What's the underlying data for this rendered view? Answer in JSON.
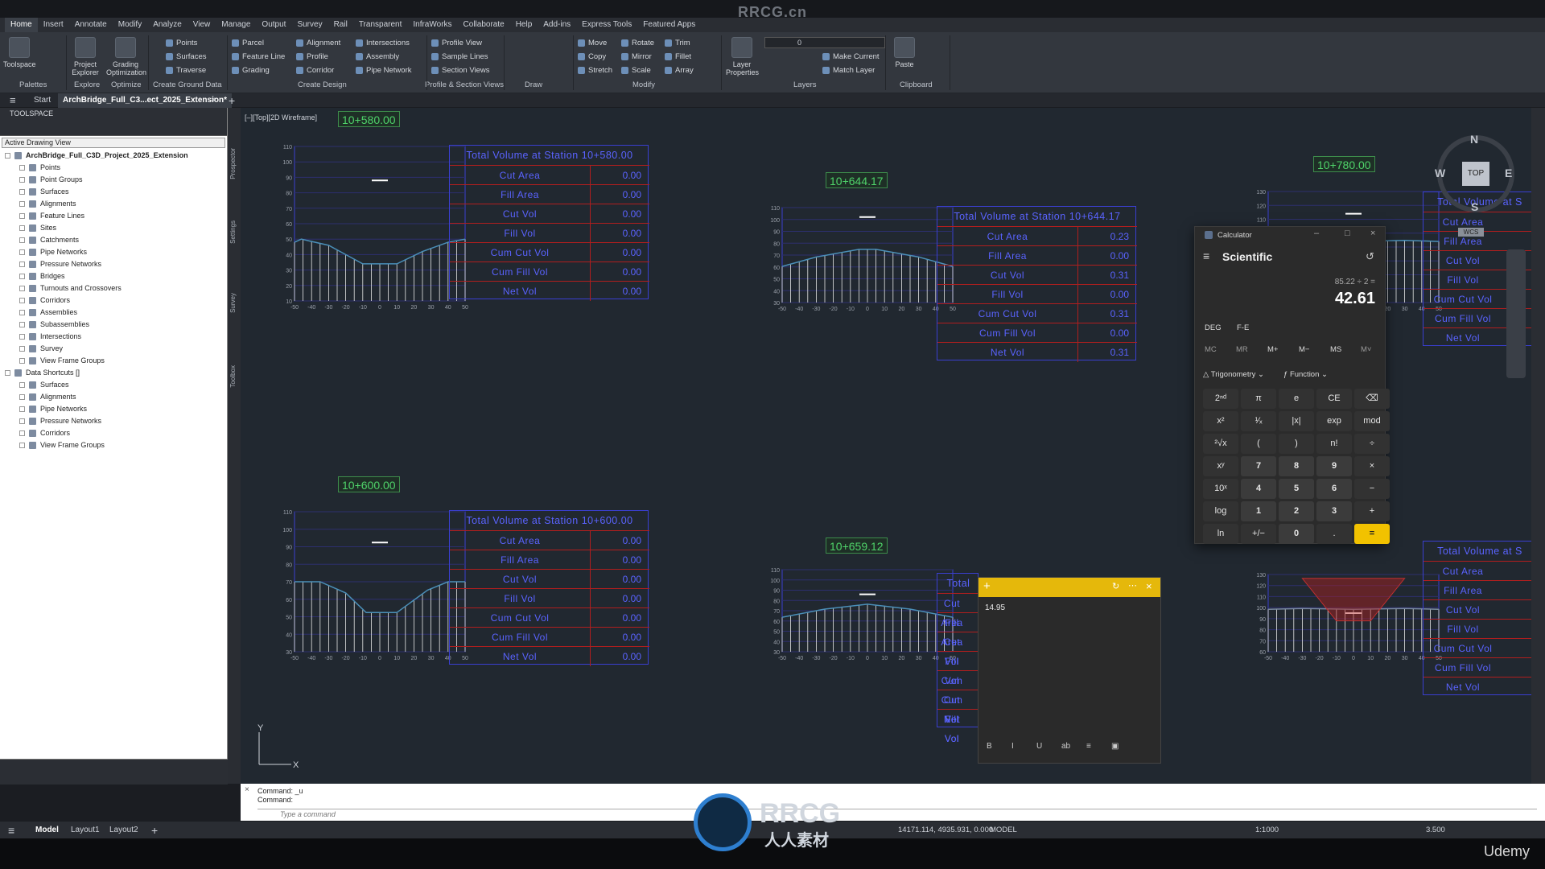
{
  "watermark": "RRCG.cn",
  "menu": [
    "Home",
    "Insert",
    "Annotate",
    "Modify",
    "Analyze",
    "View",
    "Manage",
    "Output",
    "Survey",
    "Rail",
    "Transparent",
    "InfraWorks",
    "Collaborate",
    "Help",
    "Add-ins",
    "Express Tools",
    "Featured Apps"
  ],
  "ribbon": {
    "toolspace": "Toolspace",
    "project_explorer": "Project\nExplorer",
    "grading_optimization": "Grading\nOptimization",
    "points": "Points",
    "surfaces": "Surfaces",
    "traverse": "Traverse",
    "parcel": "Parcel",
    "feature_line": "Feature Line",
    "grading": "Grading",
    "alignment": "Alignment",
    "profile": "Profile",
    "corridor": "Corridor",
    "intersections": "Intersections",
    "assembly": "Assembly",
    "pipe_network": "Pipe Network",
    "profile_view": "Profile View",
    "sample_lines": "Sample Lines",
    "section_views": "Section Views",
    "move": "Move",
    "copy": "Copy",
    "stretch": "Stretch",
    "rotate": "Rotate",
    "mirror": "Mirror",
    "scale": "Scale",
    "trim": "Trim",
    "fillet": "Fillet",
    "array": "Array",
    "layer_properties": "Layer\nProperties",
    "layer_value": "0",
    "make_current": "Make Current",
    "match_layer": "Match Layer",
    "paste": "Paste",
    "panels": [
      "Palettes",
      "Explore",
      "Optimize",
      "Create Ground Data",
      "Create Design",
      "Profile & Section Views",
      "Draw",
      "Modify",
      "Layers",
      "Clipboard"
    ]
  },
  "doctabs": {
    "start": "Start",
    "active": "ArchBridge_Full_C3...ect_2025_Extension*"
  },
  "toolspace": {
    "title": "TOOLSPACE",
    "view": "Active Drawing View",
    "tree": [
      {
        "label": "ArchBridge_Full_C3D_Project_2025_Extension",
        "level": 0,
        "bold": true
      },
      {
        "label": "Points",
        "level": 1
      },
      {
        "label": "Point Groups",
        "level": 1
      },
      {
        "label": "Surfaces",
        "level": 1
      },
      {
        "label": "Alignments",
        "level": 1
      },
      {
        "label": "Feature Lines",
        "level": 1
      },
      {
        "label": "Sites",
        "level": 1
      },
      {
        "label": "Catchments",
        "level": 1
      },
      {
        "label": "Pipe Networks",
        "level": 1
      },
      {
        "label": "Pressure Networks",
        "level": 1
      },
      {
        "label": "Bridges",
        "level": 1
      },
      {
        "label": "Turnouts and Crossovers",
        "level": 1
      },
      {
        "label": "Corridors",
        "level": 1
      },
      {
        "label": "Assemblies",
        "level": 1
      },
      {
        "label": "Subassemblies",
        "level": 1
      },
      {
        "label": "Intersections",
        "level": 1
      },
      {
        "label": "Survey",
        "level": 1
      },
      {
        "label": "View Frame Groups",
        "level": 1
      },
      {
        "label": "Data Shortcuts []",
        "level": 0
      },
      {
        "label": "Surfaces",
        "level": 1
      },
      {
        "label": "Alignments",
        "level": 1
      },
      {
        "label": "Pipe Networks",
        "level": 1
      },
      {
        "label": "Pressure Networks",
        "level": 1
      },
      {
        "label": "Corridors",
        "level": 1
      },
      {
        "label": "View Frame Groups",
        "level": 1
      }
    ]
  },
  "side_tabs": [
    "Prospector",
    "Settings",
    "Survey",
    "Toolbox"
  ],
  "viewport_label": "[–][Top][2D Wireframe]",
  "stations": [
    {
      "label": "10+580.00",
      "title": "Total Volume at Station 10+580.00",
      "values": [
        "0.00",
        "0.00",
        "0.00",
        "0.00",
        "0.00",
        "0.00",
        "0.00"
      ]
    },
    {
      "label": "10+600.00",
      "title": "Total Volume at Station 10+600.00",
      "values": [
        "0.00",
        "0.00",
        "0.00",
        "0.00",
        "0.00",
        "0.00",
        "0.00"
      ]
    },
    {
      "label": "10+644.17",
      "title": "Total Volume at Station 10+644.17",
      "values": [
        "0.23",
        "0.00",
        "0.31",
        "0.00",
        "0.31",
        "0.00",
        "0.31"
      ]
    },
    {
      "label": "10+659.12",
      "title": "Total",
      "values": []
    },
    {
      "label": "10+780.00",
      "title": "Total Volume at S",
      "values": []
    },
    {
      "label": "",
      "title": "Total Volume at S",
      "values": []
    }
  ],
  "row_labels": [
    "Cut Area",
    "Fill Area",
    "Cut Vol",
    "Fill Vol",
    "Cum Cut Vol",
    "Cum Fill Vol",
    "Net Vol"
  ],
  "axis_x_ticks": [
    "-50",
    "-40",
    "-30",
    "-20",
    "-10",
    "0",
    "10",
    "20",
    "30",
    "40",
    "50"
  ],
  "axis_y_ticks_a": [
    "110",
    "100",
    "90",
    "80",
    "70",
    "60",
    "50",
    "40",
    "30",
    "20",
    "10"
  ],
  "axis_y_ticks_b": [
    "110",
    "100",
    "90",
    "80",
    "70",
    "60",
    "50",
    "40",
    "30"
  ],
  "axis_y_ticks_c": [
    "130",
    "120",
    "110",
    "100",
    "90",
    "80",
    "70",
    "60",
    "50"
  ],
  "axis_y_ticks_d": [
    "130",
    "120",
    "110",
    "100",
    "90",
    "80",
    "70",
    "60"
  ],
  "viewcube": {
    "n": "N",
    "s": "S",
    "e": "E",
    "w": "W",
    "top": "TOP",
    "wcs": "WCS"
  },
  "calculator": {
    "window_title": "Calculator",
    "mode": "Scientific",
    "expression": "85.22 ÷ 2 =",
    "result": "42.61",
    "deg": "DEG",
    "fe": "F-E",
    "memory": [
      "MC",
      "MR",
      "M+",
      "M−",
      "MS",
      "M˅"
    ],
    "trig": "Trigonometry",
    "func": "Function",
    "keys": [
      [
        "2ⁿᵈ",
        "π",
        "e",
        "CE",
        "⌫"
      ],
      [
        "x²",
        "¹⁄ₓ",
        "|x|",
        "exp",
        "mod"
      ],
      [
        "²√x",
        "(",
        ")",
        "n!",
        "÷"
      ],
      [
        "xʸ",
        "7",
        "8",
        "9",
        "×"
      ],
      [
        "10ˣ",
        "4",
        "5",
        "6",
        "−"
      ],
      [
        "log",
        "1",
        "2",
        "3",
        "+"
      ],
      [
        "ln",
        "+/−",
        "0",
        ".",
        "="
      ]
    ]
  },
  "sticky_note": {
    "text": "14.95",
    "tools": [
      "B",
      "I",
      "U",
      "ab",
      "≡",
      "▣"
    ]
  },
  "command": {
    "history": [
      "Command: _u",
      "Command:"
    ],
    "placeholder": "Type a command"
  },
  "status": {
    "tabs": [
      "Model",
      "Layout1",
      "Layout2"
    ],
    "coords": "14171.114, 4935.931, 0.000",
    "space": "MODEL",
    "scale": "1:1000",
    "value": "3.500",
    "brand": "Udemy",
    "logo_text": "RRCG",
    "logo_sub": "人人素材"
  },
  "colors": {
    "cut_fill_blue": "#5a63ff",
    "grid_red": "#b11e1e",
    "station_green": "#4fd36a",
    "calc_accent": "#f2c200"
  }
}
